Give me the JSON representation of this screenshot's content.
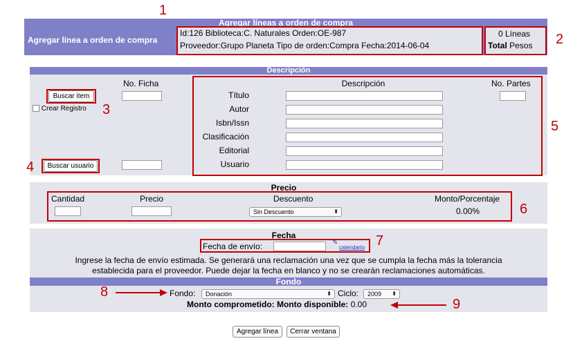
{
  "header": {
    "title": "Agregar líneas a orden de compra",
    "left_label": "Agregar línea a orden de compra",
    "info_line1": "Id:126  Biblioteca:C. Naturales  Orden:OE-987",
    "info_line2": "Proveedor:Grupo Planeta   Tipo de orden:Compra   Fecha:2014-06-04",
    "lineas": "0 Líneas",
    "total_bold": "Total",
    "total_rest": " Pesos"
  },
  "descripcion": {
    "title": "Descripción",
    "no_ficha_label": "No. Ficha",
    "buscar_item": "Buscar item",
    "crear_registro": "Crear Registro",
    "buscar_usuario": "Buscar usuario",
    "col_descripcion": "Descripción",
    "col_no_partes": "No. Partes",
    "fields": [
      "Título",
      "Autor",
      "Isbn/Issn",
      "Clasificación",
      "Editorial",
      "Usuario"
    ]
  },
  "precio": {
    "title": "Precio",
    "cantidad": "Cantidad",
    "precio": "Precio",
    "descuento": "Descuento",
    "descuento_value": "Sin Descuento",
    "monto_porcentaje": "Monto/Porcentaje",
    "monto_value": "0.00%"
  },
  "fecha": {
    "title": "Fecha",
    "fecha_envio_label": "Fecha de envío:",
    "calendario": "calendario",
    "help_line1": "Ingrese la fecha de envío estimada. Se generará una reclamación una vez que se cumpla la fecha más la tolerancia",
    "help_line2": "establecida para el proveedor. Puede dejar la fecha en blanco y no se crearán reclamaciones automáticas."
  },
  "fondo": {
    "title": "Fondo",
    "fondo_label": "Fondo:",
    "fondo_value": "Donación",
    "ciclo_label": "Ciclo:",
    "ciclo_value": "2009",
    "monto_text": "Monto comprometido: Monto disponible:",
    "monto_value": " 0.00"
  },
  "footer": {
    "agregar": "Agregar línea",
    "cerrar": "Cerrar ventana"
  },
  "markers": [
    "1",
    "2",
    "3",
    "4",
    "5",
    "6",
    "7",
    "8",
    "9"
  ],
  "colors": {
    "header": "#7f80c8",
    "panel": "#e4e4ed",
    "annotation": "#c00000"
  }
}
